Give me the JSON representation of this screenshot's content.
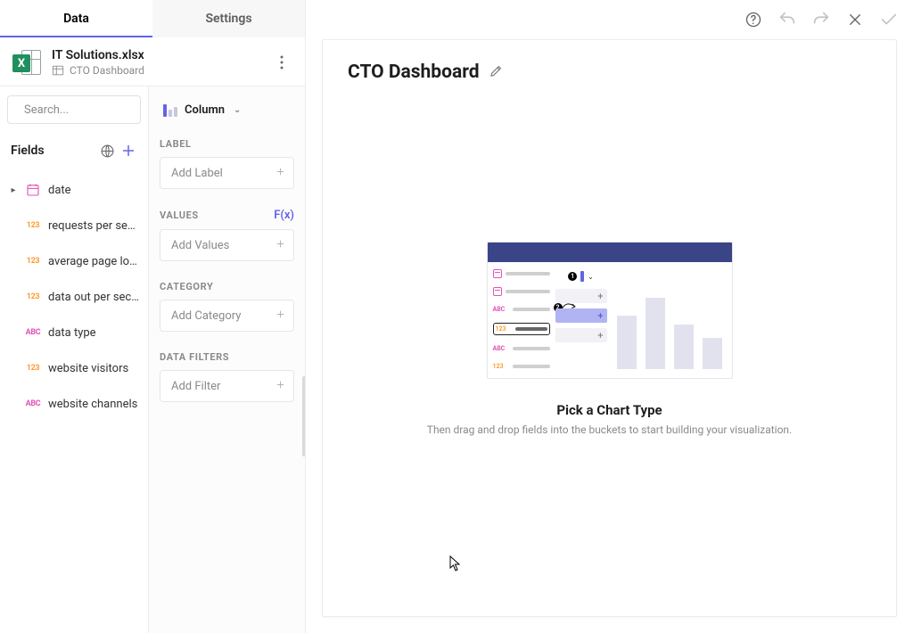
{
  "tabs": {
    "data": "Data",
    "settings": "Settings"
  },
  "file": {
    "name": "IT Solutions.xlsx",
    "sheet": "CTO Dashboard"
  },
  "search": {
    "placeholder": "Search..."
  },
  "fields_section": {
    "title": "Fields"
  },
  "fields": [
    {
      "type": "date",
      "label": "date",
      "expandable": true
    },
    {
      "type": "123",
      "label": "requests per se…"
    },
    {
      "type": "123",
      "label": "average page lo…"
    },
    {
      "type": "123",
      "label": "data out per sec…"
    },
    {
      "type": "abc",
      "label": "data type"
    },
    {
      "type": "123",
      "label": "website visitors"
    },
    {
      "type": "abc",
      "label": "website channels"
    }
  ],
  "chart_type": {
    "label": "Column"
  },
  "buckets": {
    "label": {
      "title": "LABEL",
      "placeholder": "Add Label"
    },
    "values": {
      "title": "VALUES",
      "placeholder": "Add Values",
      "fx": "F(x)"
    },
    "category": {
      "title": "CATEGORY",
      "placeholder": "Add Category"
    },
    "filters": {
      "title": "DATA FILTERS",
      "placeholder": "Add Filter"
    }
  },
  "dashboard": {
    "title": "CTO Dashboard",
    "instruction_title": "Pick a Chart Type",
    "instruction_sub": "Then drag and drop fields into the buckets to start building your visualization."
  }
}
